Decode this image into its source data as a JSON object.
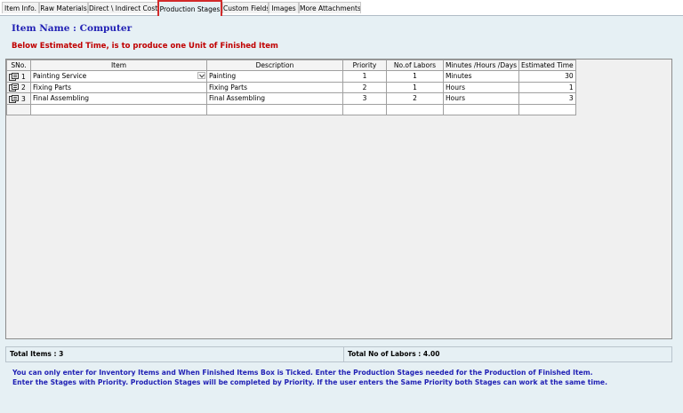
{
  "tabs": [
    {
      "label": "Item Info."
    },
    {
      "label": "Raw Materials"
    },
    {
      "label": "Direct \\ Indirect Cost"
    },
    {
      "label": "Production Stages"
    },
    {
      "label": "Custom Fields"
    },
    {
      "label": "Images"
    },
    {
      "label": "More Attachments"
    }
  ],
  "active_tab": "Production Stages",
  "item_name": "Item Name : Computer",
  "estimate_note": "Below Estimated Time, is to produce one Unit of Finished Item",
  "grid": {
    "columns": [
      "SNo.",
      "Item",
      "Description",
      "Priority",
      "No.of Labors",
      "Minutes /Hours /Days",
      "Estimated Time"
    ],
    "rows": [
      {
        "sno": "1",
        "item": "Painting Service",
        "description": "Painting",
        "priority": "1",
        "labors": "1",
        "unit": "Minutes",
        "estimated": "30"
      },
      {
        "sno": "2",
        "item": "Fixing Parts",
        "description": "Fixing Parts",
        "priority": "2",
        "labors": "1",
        "unit": "Hours",
        "estimated": "1"
      },
      {
        "sno": "3",
        "item": "Final Assembling",
        "description": "Final Assembling",
        "priority": "3",
        "labors": "2",
        "unit": "Hours",
        "estimated": "3"
      }
    ]
  },
  "totals": {
    "items": "Total Items : 3",
    "labors": "Total No of Labors : 4.00"
  },
  "info_lines": [
    "You can only enter for Inventory Items and When Finished Items Box is Ticked. Enter the Production Stages needed for the Production of Finished Item.",
    "Enter the Stages with Priority. Production Stages will be completed by Priority. If the user enters the Same Priority both Stages can work at the same time."
  ],
  "colors": {
    "accent_blue": "#1f1fb4",
    "warning_red": "#c00000",
    "panel_bg": "#e6f0f4",
    "active_tab_border": "#d22a2a"
  }
}
